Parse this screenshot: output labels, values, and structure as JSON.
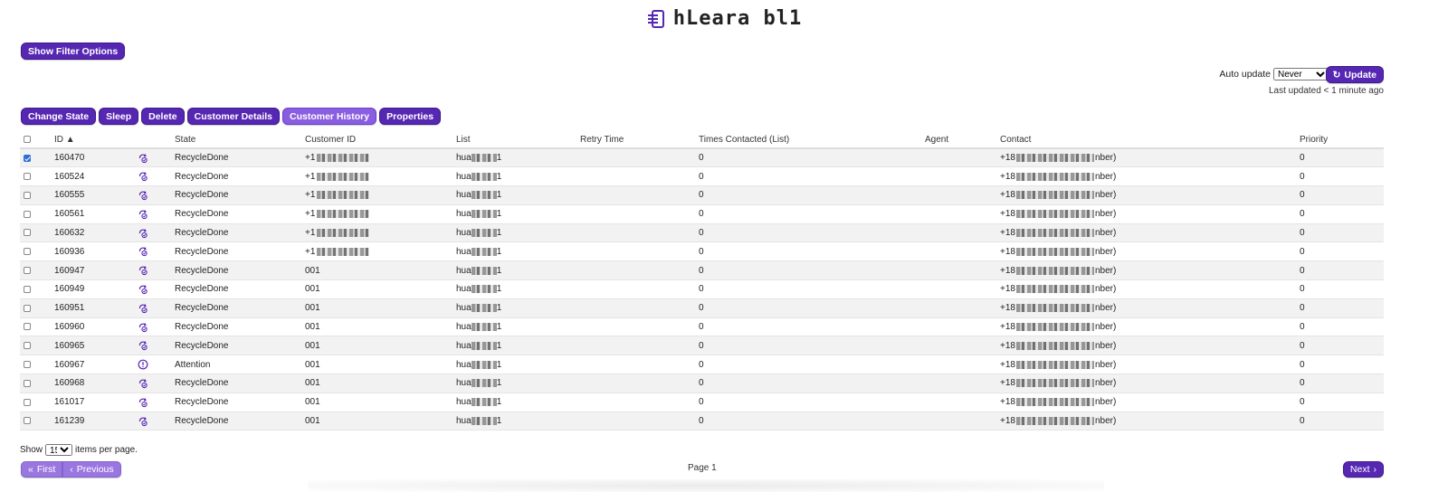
{
  "header": {
    "title": "hLeara bl1"
  },
  "filter": {
    "show_label": "Show Filter Options"
  },
  "autoupdate": {
    "label": "Auto update",
    "selected": "Never",
    "update_label": "Update",
    "last_updated": "Last updated < 1 minute ago"
  },
  "actions": [
    "Change State",
    "Sleep",
    "Delete",
    "Customer Details",
    "Customer History",
    "Properties"
  ],
  "table": {
    "headers": {
      "id": "ID",
      "state": "State",
      "customer_id": "Customer ID",
      "list": "List",
      "retry": "Retry Time",
      "times": "Times Contacted (List)",
      "agent": "Agent",
      "contact": "Contact",
      "priority": "Priority"
    },
    "rows": [
      {
        "id": "160470",
        "state": "RecycleDone",
        "icon": "recycle-icon",
        "cust": "+1",
        "cust_blur": true,
        "list": "hua",
        "times": "0",
        "contact": "+18",
        "contact_tail": "nber)",
        "priority": "0",
        "checked": true
      },
      {
        "id": "160524",
        "state": "RecycleDone",
        "icon": "recycle-icon",
        "cust": "+1",
        "cust_blur": true,
        "list": "hua",
        "times": "0",
        "contact": "+18",
        "contact_tail": "nber)",
        "priority": "0",
        "checked": false
      },
      {
        "id": "160555",
        "state": "RecycleDone",
        "icon": "recycle-icon",
        "cust": "+1",
        "cust_blur": true,
        "list": "hua",
        "times": "0",
        "contact": "+18",
        "contact_tail": "nber)",
        "priority": "0",
        "checked": false
      },
      {
        "id": "160561",
        "state": "RecycleDone",
        "icon": "recycle-icon",
        "cust": "+1",
        "cust_blur": true,
        "list": "hua",
        "times": "0",
        "contact": "+18",
        "contact_tail": "nber)",
        "priority": "0",
        "checked": false
      },
      {
        "id": "160632",
        "state": "RecycleDone",
        "icon": "recycle-icon",
        "cust": "+1",
        "cust_blur": true,
        "list": "hua",
        "times": "0",
        "contact": "+18",
        "contact_tail": "nber)",
        "priority": "0",
        "checked": false
      },
      {
        "id": "160936",
        "state": "RecycleDone",
        "icon": "recycle-icon",
        "cust": "+1",
        "cust_blur": true,
        "list": "hua",
        "times": "0",
        "contact": "+18",
        "contact_tail": "nber)",
        "priority": "0",
        "checked": false
      },
      {
        "id": "160947",
        "state": "RecycleDone",
        "icon": "recycle-icon",
        "cust": "001",
        "cust_blur": false,
        "list": "hua",
        "times": "0",
        "contact": "+18",
        "contact_tail": "nber)",
        "priority": "0",
        "checked": false
      },
      {
        "id": "160949",
        "state": "RecycleDone",
        "icon": "recycle-icon",
        "cust": "001",
        "cust_blur": false,
        "list": "hua",
        "times": "0",
        "contact": "+18",
        "contact_tail": "nber)",
        "priority": "0",
        "checked": false
      },
      {
        "id": "160951",
        "state": "RecycleDone",
        "icon": "recycle-icon",
        "cust": "001",
        "cust_blur": false,
        "list": "hua",
        "times": "0",
        "contact": "+18",
        "contact_tail": "nber)",
        "priority": "0",
        "checked": false
      },
      {
        "id": "160960",
        "state": "RecycleDone",
        "icon": "recycle-icon",
        "cust": "001",
        "cust_blur": false,
        "list": "hua",
        "times": "0",
        "contact": "+18",
        "contact_tail": "nber)",
        "priority": "0",
        "checked": false
      },
      {
        "id": "160965",
        "state": "RecycleDone",
        "icon": "recycle-icon",
        "cust": "001",
        "cust_blur": false,
        "list": "hua",
        "times": "0",
        "contact": "+18",
        "contact_tail": "nber)",
        "priority": "0",
        "checked": false
      },
      {
        "id": "160967",
        "state": "Attention",
        "icon": "attention-icon",
        "cust": "001",
        "cust_blur": false,
        "list": "hua",
        "times": "0",
        "contact": "+18",
        "contact_tail": "nber)",
        "priority": "0",
        "checked": false
      },
      {
        "id": "160968",
        "state": "RecycleDone",
        "icon": "recycle-icon",
        "cust": "001",
        "cust_blur": false,
        "list": "hua",
        "times": "0",
        "contact": "+18",
        "contact_tail": "nber)",
        "priority": "0",
        "checked": false
      },
      {
        "id": "161017",
        "state": "RecycleDone",
        "icon": "recycle-icon",
        "cust": "001",
        "cust_blur": false,
        "list": "hua",
        "times": "0",
        "contact": "+18",
        "contact_tail": "nber)",
        "priority": "0",
        "checked": false
      },
      {
        "id": "161239",
        "state": "RecycleDone",
        "icon": "recycle-icon",
        "cust": "001",
        "cust_blur": false,
        "list": "hua",
        "times": "0",
        "contact": "+18",
        "contact_tail": "nber)",
        "priority": "0",
        "checked": false
      }
    ]
  },
  "pager": {
    "show_label": "Show",
    "per_page": "15",
    "items_label": "items per page.",
    "first": "First",
    "previous": "Previous",
    "page_label": "Page 1",
    "next": "Next"
  },
  "colors": {
    "accent": "#5627b3",
    "accent_light": "#8a5ee0"
  }
}
